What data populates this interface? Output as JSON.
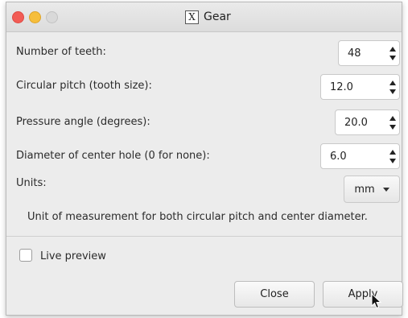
{
  "window": {
    "title": "Gear",
    "app_icon": "x11-icon"
  },
  "fields": [
    {
      "label": "Number of teeth:",
      "value": "48"
    },
    {
      "label": "Circular pitch (tooth size):",
      "value": "12.0"
    },
    {
      "label": "Pressure angle (degrees):",
      "value": "20.0"
    },
    {
      "label": "Diameter of center hole (0 for none):",
      "value": "6.0"
    }
  ],
  "units": {
    "label": "Units:",
    "selected": "mm",
    "help": "Unit of measurement for both circular pitch and center diameter."
  },
  "preview": {
    "label": "Live preview",
    "checked": false
  },
  "buttons": {
    "close": "Close",
    "apply": "Apply"
  }
}
